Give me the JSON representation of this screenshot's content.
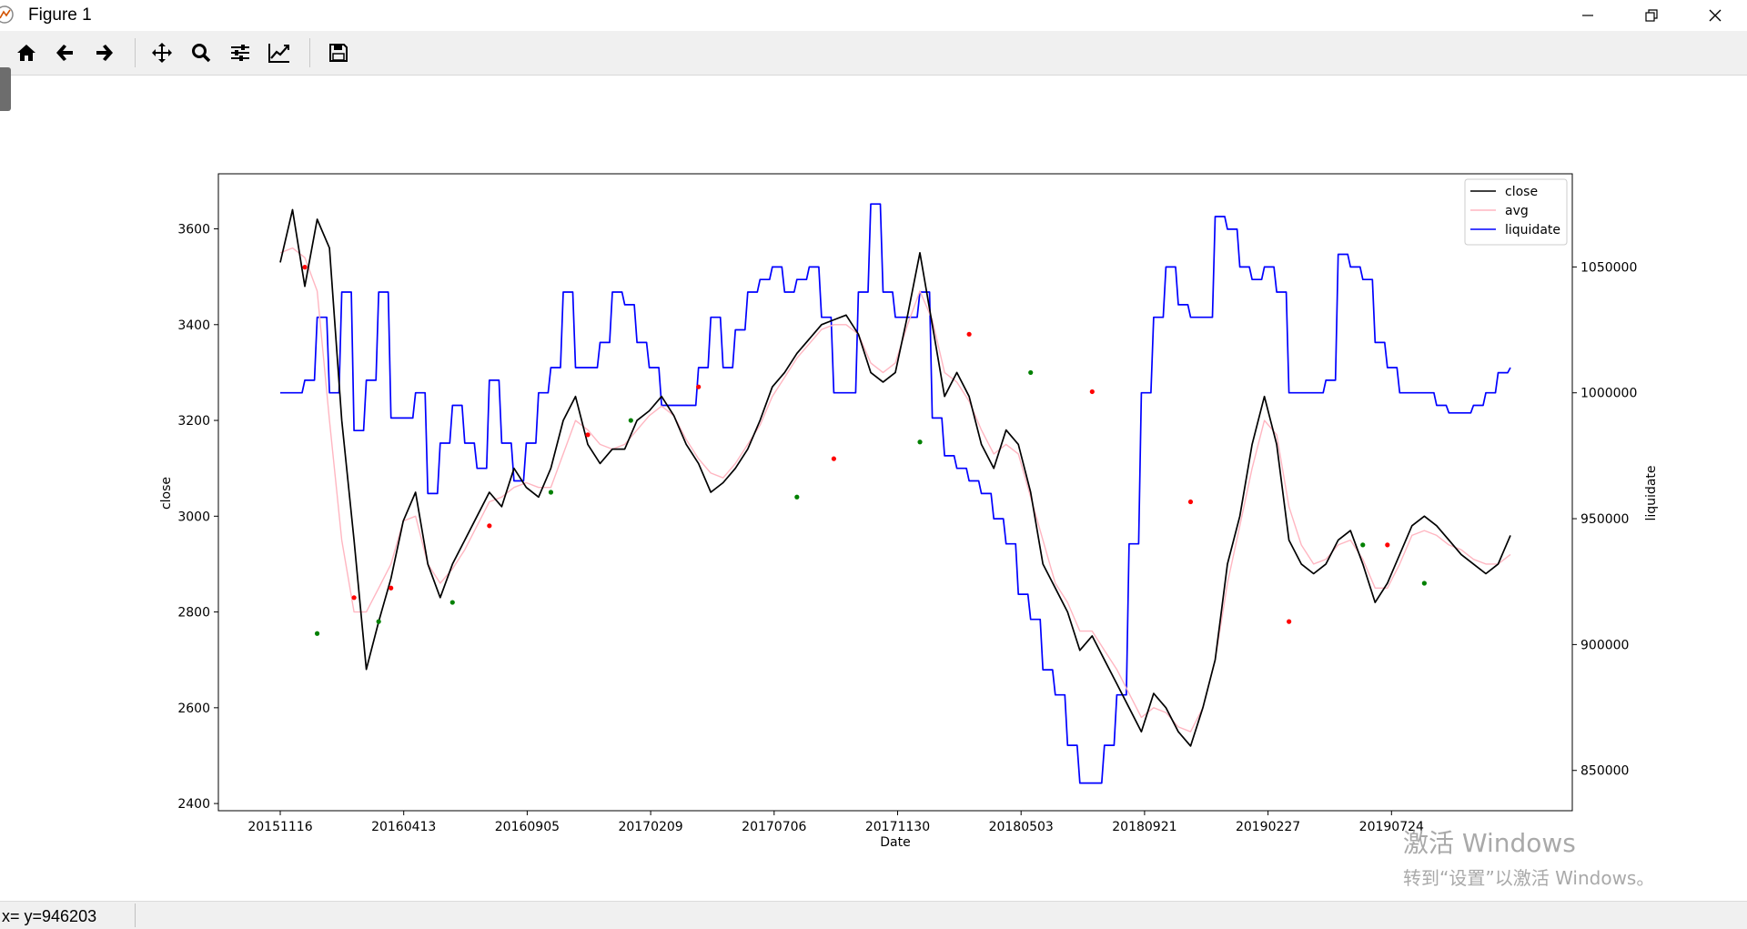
{
  "window": {
    "title": "Figure 1"
  },
  "toolbar": {
    "tools": [
      "home-icon",
      "back-icon",
      "forward-icon",
      "pan-icon",
      "zoom-icon",
      "configure-subplots-icon",
      "edit-axis-icon",
      "save-icon"
    ]
  },
  "status": {
    "coords": "x= y=946203"
  },
  "watermark": {
    "line1": "激活 Windows",
    "line2": "转到“设置”以激活 Windows。"
  },
  "chart_data": {
    "type": "line",
    "xlabel": "Date",
    "ylabel_left": "close",
    "ylabel_right": "liquidate",
    "x_ticks": [
      "20151116",
      "20160413",
      "20160905",
      "20170209",
      "20170706",
      "20171130",
      "20180503",
      "20180921",
      "20190227",
      "20190724"
    ],
    "y_left_ticks": [
      2400,
      2600,
      2800,
      3000,
      3200,
      3400,
      3600
    ],
    "y_right_ticks": [
      "850000",
      "900000",
      "950000",
      "1000000",
      "1050000"
    ],
    "y_left_lim": [
      2385,
      3715
    ],
    "y_right_lim": [
      834000,
      1087000
    ],
    "legend": {
      "position": "upper right",
      "entries": [
        "close",
        "avg",
        "liquidate"
      ]
    },
    "colors": {
      "close": "#000000",
      "avg": "#ffb6c1",
      "liquidate": "#0000ff",
      "buy_marker": "#008000",
      "sell_marker": "#ff0000"
    },
    "x_index": [
      0,
      10,
      20,
      30,
      40,
      50,
      60,
      70,
      80,
      90,
      100,
      110,
      120,
      130,
      140,
      150,
      160,
      170,
      180,
      190,
      200,
      210,
      220,
      230,
      240,
      250,
      260,
      270,
      280,
      290,
      300,
      310,
      320,
      330,
      340,
      350,
      360,
      370,
      380,
      390,
      400,
      410,
      420,
      430,
      440,
      450,
      460,
      470,
      480,
      490,
      500,
      510,
      520,
      530,
      540,
      550,
      560,
      570,
      580,
      590,
      600,
      610,
      620,
      630,
      640,
      650,
      660,
      670,
      680,
      690,
      700,
      710,
      720,
      730,
      740,
      750,
      760,
      770,
      780,
      790,
      800,
      810,
      820,
      830,
      840,
      850,
      860,
      870,
      880,
      890,
      900,
      910,
      920,
      930,
      940,
      950,
      960,
      970,
      980,
      990,
      1000
    ],
    "series": [
      {
        "name": "close",
        "axis": "left",
        "values": [
          3530,
          3640,
          3480,
          3620,
          3560,
          3200,
          2950,
          2680,
          2780,
          2870,
          2990,
          3050,
          2900,
          2830,
          2900,
          2950,
          3000,
          3050,
          3020,
          3100,
          3060,
          3040,
          3100,
          3200,
          3250,
          3150,
          3110,
          3140,
          3140,
          3200,
          3220,
          3250,
          3210,
          3150,
          3110,
          3050,
          3070,
          3100,
          3140,
          3200,
          3270,
          3300,
          3340,
          3370,
          3400,
          3410,
          3420,
          3380,
          3300,
          3280,
          3300,
          3420,
          3550,
          3400,
          3250,
          3300,
          3250,
          3150,
          3100,
          3180,
          3150,
          3050,
          2900,
          2850,
          2800,
          2720,
          2750,
          2700,
          2650,
          2600,
          2550,
          2630,
          2600,
          2550,
          2520,
          2600,
          2700,
          2900,
          3000,
          3150,
          3250,
          3150,
          2950,
          2900,
          2880,
          2900,
          2950,
          2970,
          2900,
          2820,
          2860,
          2920,
          2980,
          3000,
          2980,
          2950,
          2920,
          2900,
          2880,
          2900,
          2960
        ]
      },
      {
        "name": "avg",
        "axis": "left",
        "values": [
          3550,
          3560,
          3540,
          3470,
          3200,
          2950,
          2800,
          2800,
          2850,
          2900,
          2990,
          3000,
          2900,
          2860,
          2890,
          2930,
          2980,
          3030,
          3040,
          3060,
          3070,
          3060,
          3060,
          3130,
          3200,
          3180,
          3150,
          3140,
          3150,
          3180,
          3210,
          3230,
          3210,
          3160,
          3120,
          3090,
          3080,
          3110,
          3150,
          3190,
          3250,
          3290,
          3330,
          3360,
          3390,
          3400,
          3400,
          3380,
          3320,
          3300,
          3320,
          3400,
          3470,
          3410,
          3300,
          3280,
          3240,
          3180,
          3130,
          3150,
          3130,
          3040,
          2950,
          2860,
          2820,
          2760,
          2760,
          2720,
          2680,
          2630,
          2580,
          2600,
          2590,
          2560,
          2550,
          2600,
          2700,
          2860,
          2980,
          3100,
          3200,
          3170,
          3020,
          2940,
          2900,
          2910,
          2940,
          2950,
          2910,
          2850,
          2850,
          2900,
          2960,
          2970,
          2960,
          2940,
          2930,
          2910,
          2900,
          2900,
          2920
        ]
      },
      {
        "name": "liquidate",
        "axis": "right",
        "values": [
          1000000,
          1000000,
          1005000,
          1030000,
          1000000,
          1040000,
          985000,
          1005000,
          1040000,
          990000,
          990000,
          1000000,
          960000,
          980000,
          995000,
          980000,
          970000,
          1005000,
          980000,
          965000,
          980000,
          1000000,
          1010000,
          1040000,
          1010000,
          1010000,
          1020000,
          1040000,
          1035000,
          1020000,
          1010000,
          995000,
          995000,
          995000,
          1010000,
          1030000,
          1010000,
          1025000,
          1040000,
          1045000,
          1050000,
          1040000,
          1045000,
          1050000,
          1030000,
          1000000,
          1000000,
          1040000,
          1075000,
          1040000,
          1030000,
          1030000,
          1040000,
          990000,
          975000,
          970000,
          965000,
          960000,
          950000,
          940000,
          920000,
          910000,
          890000,
          880000,
          860000,
          845000,
          845000,
          860000,
          880000,
          940000,
          1000000,
          1030000,
          1050000,
          1035000,
          1030000,
          1030000,
          1070000,
          1065000,
          1050000,
          1045000,
          1050000,
          1040000,
          1000000,
          1000000,
          1000000,
          1005000,
          1055000,
          1050000,
          1045000,
          1020000,
          1010000,
          1000000,
          1000000,
          1000000,
          995000,
          992000,
          992000,
          995000,
          1000000,
          1008000,
          1010000
        ]
      }
    ],
    "buy_signals": [
      [
        30,
        2755
      ],
      [
        80,
        2780
      ],
      [
        140,
        2820
      ],
      [
        220,
        3050
      ],
      [
        285,
        3200
      ],
      [
        420,
        3040
      ],
      [
        520,
        3155
      ],
      [
        610,
        3300
      ],
      [
        880,
        2940
      ],
      [
        930,
        2860
      ]
    ],
    "sell_signals": [
      [
        20,
        3520
      ],
      [
        60,
        2830
      ],
      [
        90,
        2850
      ],
      [
        170,
        2980
      ],
      [
        250,
        3170
      ],
      [
        340,
        3270
      ],
      [
        450,
        3120
      ],
      [
        560,
        3380
      ],
      [
        660,
        3260
      ],
      [
        740,
        3030
      ],
      [
        820,
        2780
      ],
      [
        900,
        2940
      ]
    ]
  }
}
